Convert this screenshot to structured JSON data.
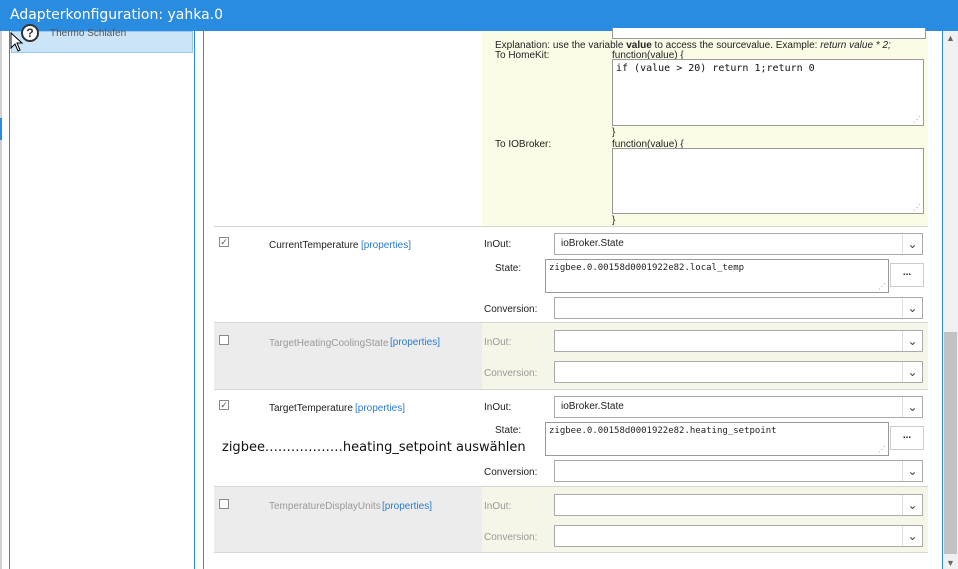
{
  "window": {
    "title": "Adapterkonfiguration: yahka.0"
  },
  "sidebar": {
    "selected_item_label": "Thermo Schlafen"
  },
  "explanation": {
    "prefix": "Explanation: use the variable ",
    "keyword": "value",
    "middle": " to access the sourcevalue. Example: ",
    "example": "return value * 2;",
    "to_homekit_label": "To HomeKit:",
    "to_iobroker_label": "To IOBroker:",
    "function_open": "function(value) {",
    "function_close": "}",
    "homekit_code": "if (value > 20) return 1;return 0",
    "iobroker_code": ""
  },
  "labels": {
    "inout": "InOut:",
    "state": "State:",
    "conversion": "Conversion:",
    "properties": "[properties]",
    "dots": "..."
  },
  "characteristics": [
    {
      "name": "CurrentTemperature",
      "checked": true,
      "inout_value": "ioBroker.State",
      "state_value": "zigbee.0.00158d0001922e82.local_temp",
      "conversion_value": ""
    },
    {
      "name": "TargetHeatingCoolingState",
      "checked": false,
      "inout_value": "",
      "conversion_value": ""
    },
    {
      "name": "TargetTemperature",
      "checked": true,
      "inout_value": "ioBroker.State",
      "state_value": "zigbee.0.00158d0001922e82.heating_setpoint",
      "conversion_value": ""
    },
    {
      "name": "TemperatureDisplayUnits",
      "checked": false,
      "inout_value": "",
      "conversion_value": ""
    }
  ],
  "annotation": {
    "text": "zigbee………………heating_setpoint auswählen"
  },
  "icons": {
    "help": "help-icon",
    "cursor": "mouse-cursor-icon",
    "dropdown": "chevron-down-icon",
    "check": "checkmark-icon"
  },
  "colors": {
    "titlebar": "#2a8ce0",
    "link": "#2a7bd0",
    "explanation_bg": "#fbfbe6",
    "selected_item": "#cce4f7"
  }
}
